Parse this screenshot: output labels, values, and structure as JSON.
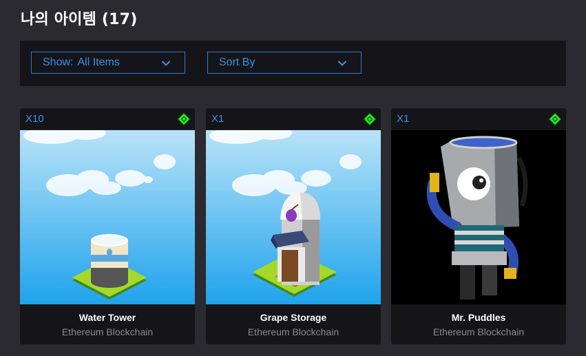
{
  "page": {
    "title": "나의 아이템 (17)"
  },
  "filters": {
    "show_label": "Show:",
    "show_value": "All Items",
    "sort_label": "Sort By"
  },
  "items": [
    {
      "quantity": "X10",
      "name": "Water Tower",
      "chain": "Ethereum Blockchain",
      "icon": "water-tower"
    },
    {
      "quantity": "X1",
      "name": "Grape Storage",
      "chain": "Ethereum Blockchain",
      "icon": "grape-storage"
    },
    {
      "quantity": "X1",
      "name": "Mr. Puddles",
      "chain": "Ethereum Blockchain",
      "icon": "mr-puddles-robot"
    }
  ],
  "colors": {
    "accent_blue": "#3b8fe8",
    "chain_badge_green": "#2ee82a",
    "background": "#2b2a30",
    "panel": "#151519"
  }
}
